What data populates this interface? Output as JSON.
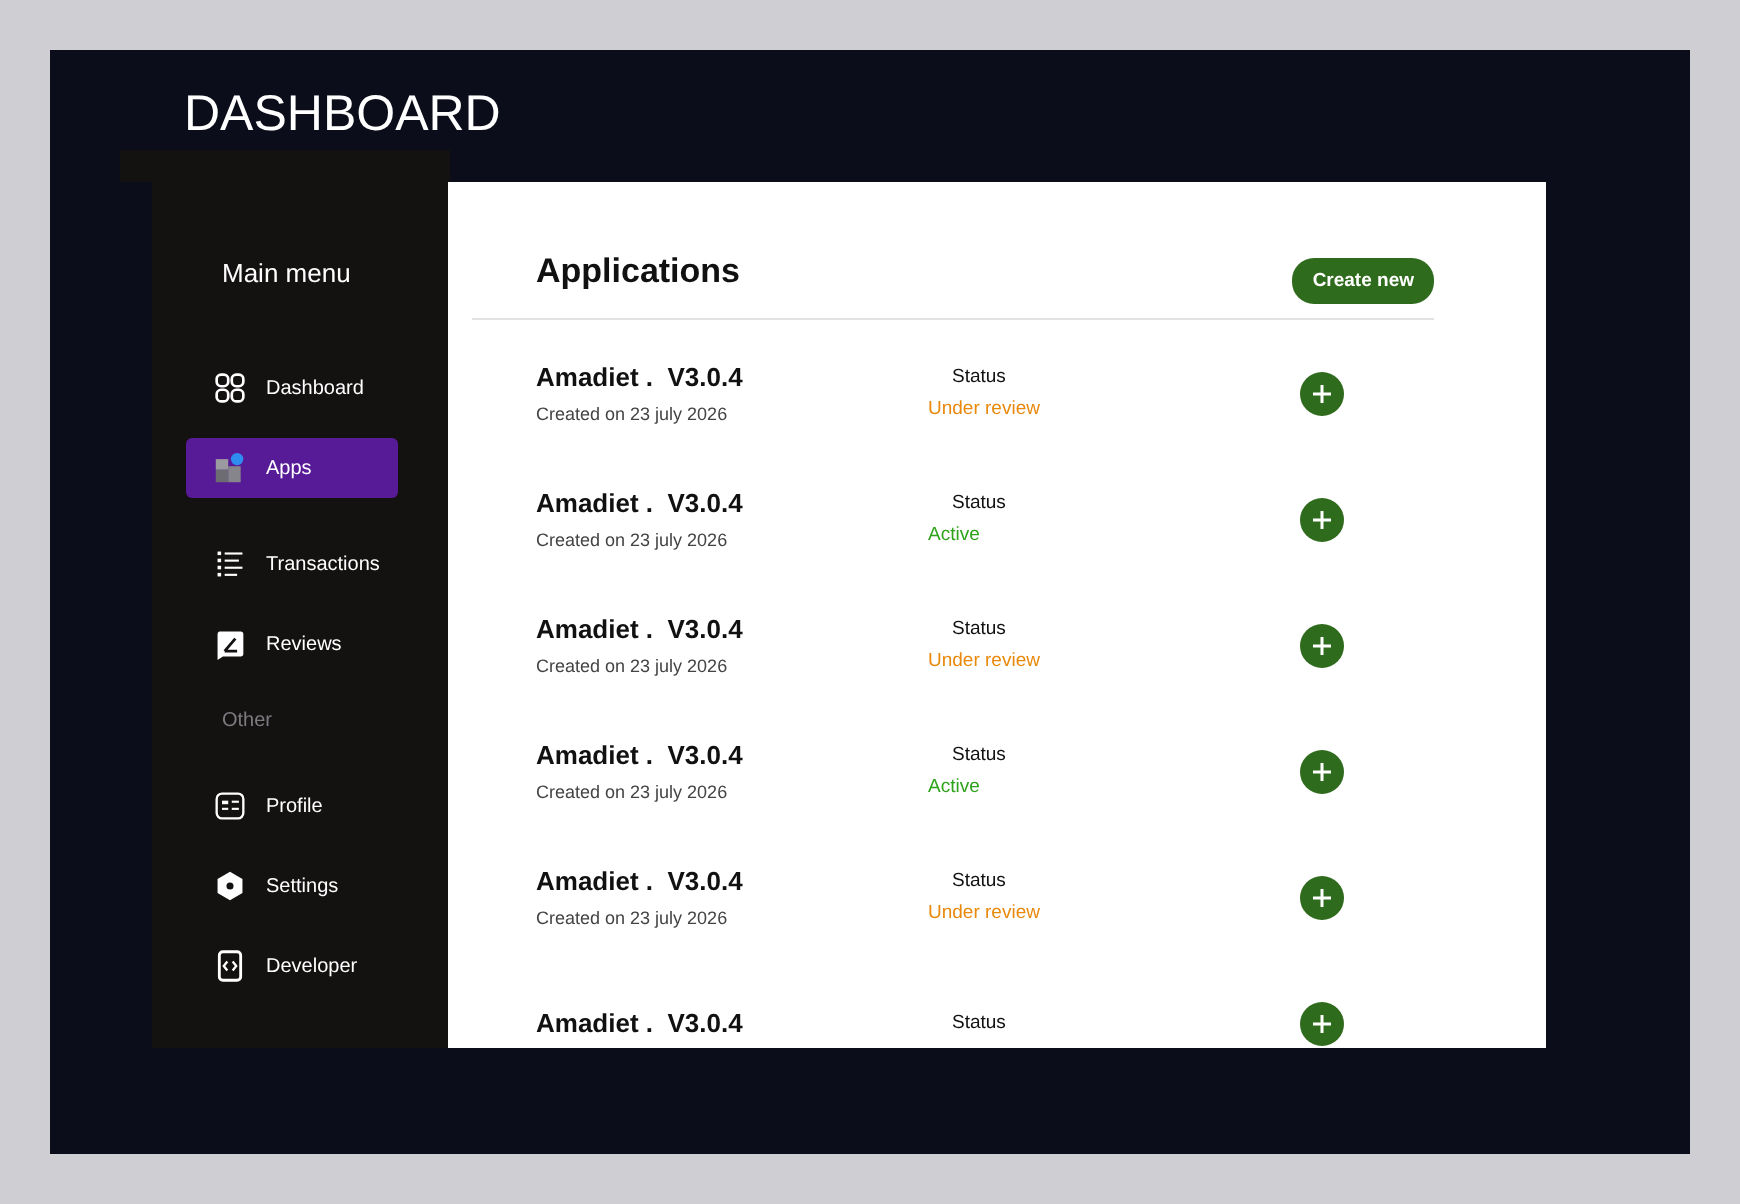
{
  "page_title": "DASHBOARD",
  "sidebar": {
    "heading": "Main menu",
    "items": [
      {
        "label": "Dashboard",
        "kind": "grid",
        "selected": false
      },
      {
        "label": "Apps",
        "kind": "apps",
        "selected": true
      },
      {
        "label": "Transactions",
        "kind": "list",
        "selected": false
      },
      {
        "label": "Reviews",
        "kind": "review",
        "selected": false
      }
    ],
    "section_label": "Other",
    "other_items": [
      {
        "label": "Profile",
        "kind": "card",
        "selected": false
      },
      {
        "label": "Settings",
        "kind": "hex",
        "selected": false
      },
      {
        "label": "Developer",
        "kind": "code",
        "selected": false
      }
    ]
  },
  "main": {
    "title": "Applications",
    "create_button": "Create new",
    "rows": [
      {
        "name": "Amadiet .  V3.0.4",
        "created": "Created on 23 july 2026",
        "status_label": "Status",
        "status": "Under review",
        "kind": "review"
      },
      {
        "name": "Amadiet .  V3.0.4",
        "created": "Created on 23 july 2026",
        "status_label": "Status",
        "status": "Active",
        "kind": "active"
      },
      {
        "name": "Amadiet .  V3.0.4",
        "created": "Created on 23 july 2026",
        "status_label": "Status",
        "status": "Under review",
        "kind": "review"
      },
      {
        "name": "Amadiet .  V3.0.4",
        "created": "Created on 23 july 2026",
        "status_label": "Status",
        "status": "Active",
        "kind": "active"
      },
      {
        "name": "Amadiet .  V3.0.4",
        "created": "Created on 23 july 2026",
        "status_label": "Status",
        "status": "Under review",
        "kind": "review"
      },
      {
        "name": "Amadiet .  V3.0.4",
        "status_label": "Status"
      }
    ]
  }
}
